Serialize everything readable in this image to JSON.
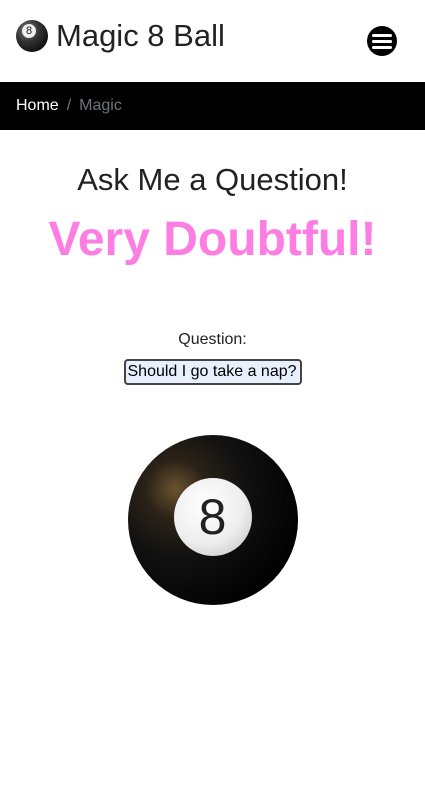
{
  "header": {
    "title": "Magic 8 Ball",
    "logo_icon": "8-ball-icon",
    "menu_icon": "hamburger-menu-icon"
  },
  "breadcrumb": {
    "home": "Home",
    "separator": "/",
    "current": "Magic"
  },
  "main": {
    "heading": "Ask Me a Question!",
    "answer": "Very Doubtful!",
    "answer_color": "#fd7ee3",
    "question_label": "Question:",
    "question_value": "Should I go take a nap?",
    "ball_number": "8"
  }
}
